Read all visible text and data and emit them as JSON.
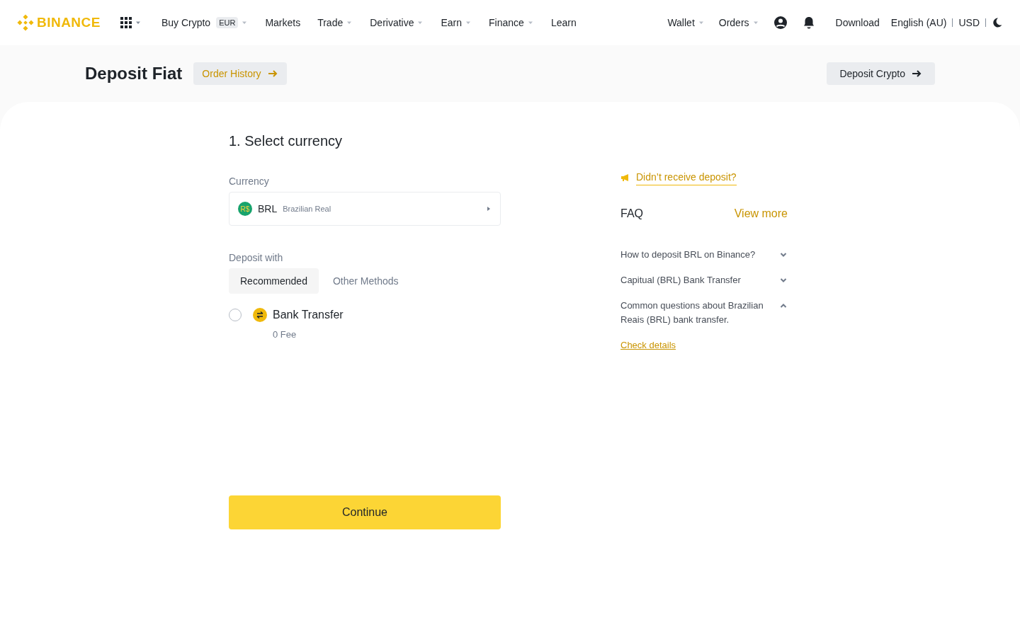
{
  "header": {
    "logo": "BINANCE",
    "nav": [
      {
        "label": "Buy Crypto",
        "badge": "EUR",
        "dropdown": true
      },
      {
        "label": "Markets",
        "dropdown": false
      },
      {
        "label": "Trade",
        "dropdown": true
      },
      {
        "label": "Derivative",
        "dropdown": true
      },
      {
        "label": "Earn",
        "dropdown": true
      },
      {
        "label": "Finance",
        "dropdown": true
      },
      {
        "label": "Learn",
        "dropdown": false
      }
    ],
    "right": [
      {
        "label": "Wallet",
        "dropdown": true
      },
      {
        "label": "Orders",
        "dropdown": true
      }
    ],
    "download": "Download",
    "language": "English (AU)",
    "currency": "USD"
  },
  "page": {
    "title": "Deposit Fiat",
    "order_history": "Order History",
    "deposit_crypto": "Deposit Crypto"
  },
  "form": {
    "step": "1. Select currency",
    "currency_label": "Currency",
    "currency": {
      "symbol": "R$",
      "code": "BRL",
      "name": "Brazilian Real"
    },
    "deposit_label": "Deposit with",
    "tabs": [
      {
        "label": "Recommended",
        "selected": true
      },
      {
        "label": "Other Methods",
        "selected": false
      }
    ],
    "methods": [
      {
        "name": "Bank Transfer",
        "fee": "0 Fee",
        "selected": false
      }
    ],
    "continue": "Continue"
  },
  "side": {
    "notice": "Didn’t receive deposit?",
    "faq_title": "FAQ",
    "view_more": "View more",
    "faq": [
      {
        "question": "How to deposit BRL on Binance?",
        "expanded": false
      },
      {
        "question": "Capitual (BRL) Bank Transfer",
        "expanded": false
      },
      {
        "question": "Common questions about Brazilian Reais (BRL) bank transfer.",
        "expanded": true,
        "link": "Check details"
      }
    ]
  }
}
